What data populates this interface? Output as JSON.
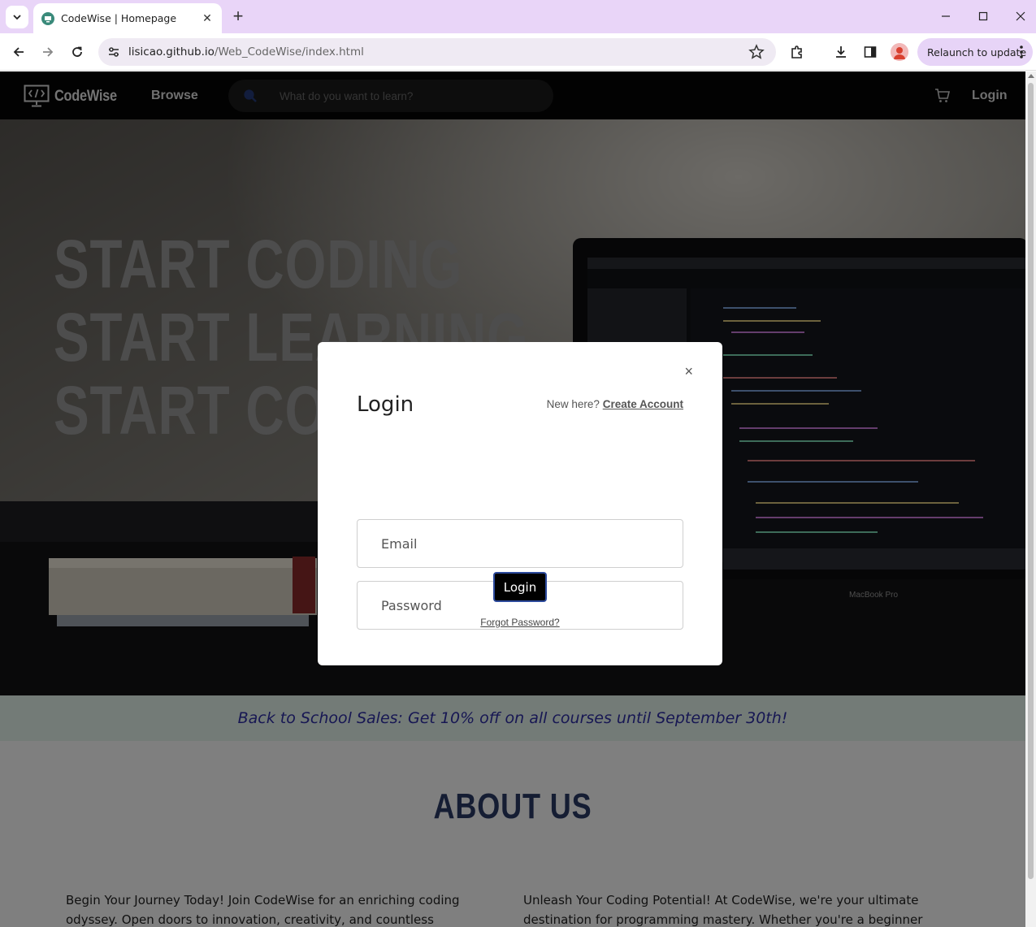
{
  "browser": {
    "tab_title": "CodeWise | Homepage",
    "url_host": "lisicao.github.io",
    "url_path": "/Web_CodeWise/index.html",
    "relaunch_label": "Relaunch to update"
  },
  "site": {
    "brand": "CodeWise",
    "browse_label": "Browse",
    "search_placeholder": "What do you want to learn?",
    "login_label": "Login"
  },
  "hero": {
    "lines": [
      "START CODING",
      "START LEARNING",
      "START CODING"
    ],
    "laptop_caption": "MacBook Pro"
  },
  "promo": {
    "text": "Back to School Sales: Get 10% off on all courses until September 30th!"
  },
  "about": {
    "title": "ABOUT US",
    "left_text": "Begin Your Journey Today! Join CodeWise for an enriching coding odyssey. Open doors to innovation, creativity, and countless opportunities. Unleash",
    "right_text": "Unleash Your Coding Potential! At CodeWise, we're your ultimate destination for programming mastery. Whether you're a beginner or a"
  },
  "modal": {
    "title": "Login",
    "close_glyph": "×",
    "new_here": "New here?",
    "create_account": "Create Account",
    "email_placeholder": "Email",
    "password_placeholder": "Password",
    "login_button": "Login",
    "forgot_password": "Forgot Password?"
  },
  "colors": {
    "tabbar_bg": "#e9d5f8",
    "nav_bg": "#050505",
    "promo_bg": "#e6f6ef",
    "promo_text": "#2f2fa6",
    "about_title": "#2b3a67"
  }
}
